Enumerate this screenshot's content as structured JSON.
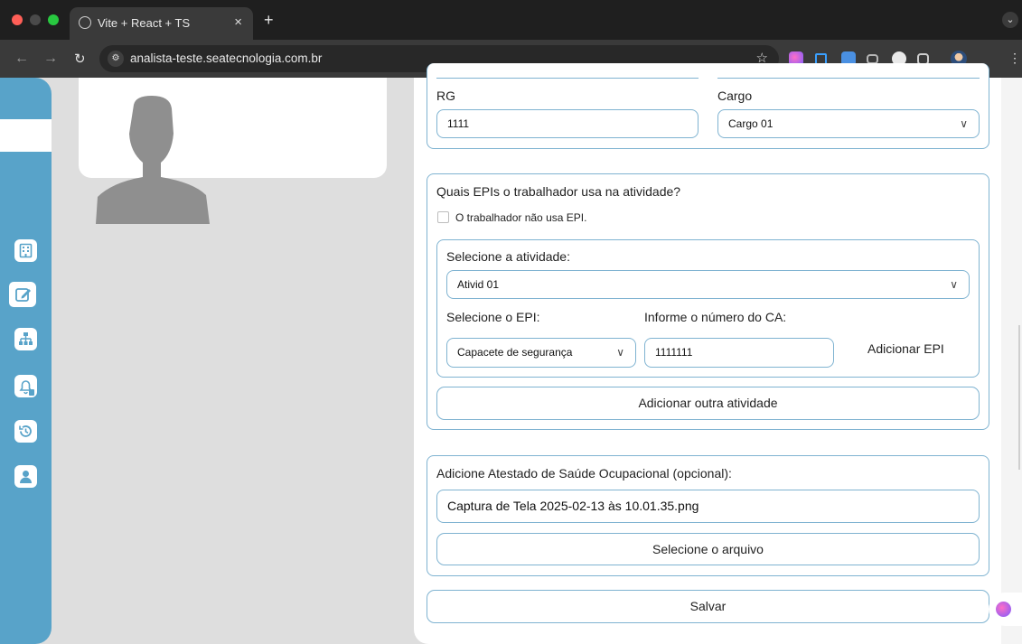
{
  "browser": {
    "tab_title": "Vite + React + TS",
    "tab_close": "×",
    "new_tab": "+",
    "address": "analista-teste.seatecnologia.com.br"
  },
  "colors": {
    "sidebar": "#58a3c9",
    "border": "#7fb3d1",
    "panel": "#ffffff",
    "background": "#dedede"
  },
  "sidebar": {
    "items": [
      {
        "icon": "building-icon"
      },
      {
        "icon": "edit-icon",
        "active": true
      },
      {
        "icon": "org-chart-icon"
      },
      {
        "icon": "bell-document-icon"
      },
      {
        "icon": "history-icon"
      },
      {
        "icon": "user-icon"
      }
    ]
  },
  "worker": {
    "rg_label": "RG",
    "rg_value": "1111",
    "cargo_label": "Cargo",
    "cargo_value": "Cargo 01"
  },
  "epi": {
    "question": "Quais EPIs o trabalhador usa na atividade?",
    "no_epi_label": "O trabalhador não usa EPI.",
    "no_epi_checked": false,
    "activity_label": "Selecione a atividade:",
    "activity_value": "Ativid 01",
    "epi_label": "Selecione o EPI:",
    "epi_value": "Capacete de segurança",
    "ca_label": "Informe o número do CA:",
    "ca_value": "1111111",
    "add_epi": "Adicionar EPI",
    "add_activity": "Adicionar outra atividade"
  },
  "aso": {
    "label": "Adicione Atestado de Saúde Ocupacional (opcional):",
    "file_name": "Captura de Tela 2025-02-13 às 10.01.35.png",
    "select_file": "Selecione o arquivo"
  },
  "save": "Salvar"
}
